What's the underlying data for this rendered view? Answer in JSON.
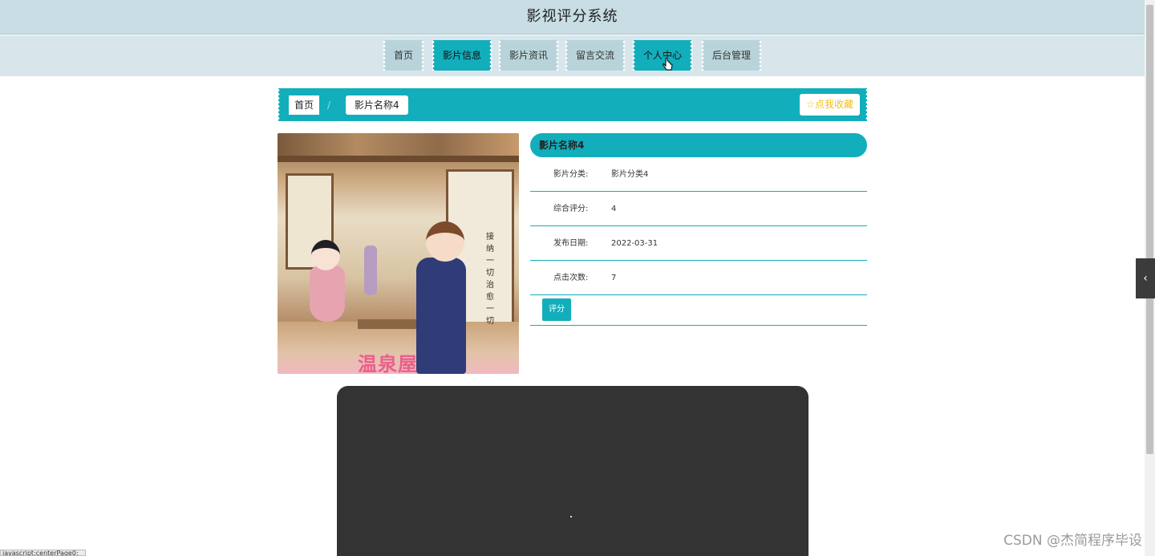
{
  "header": {
    "title": "影视评分系统"
  },
  "nav": {
    "items": [
      {
        "label": "首页",
        "active": false
      },
      {
        "label": "影片信息",
        "active": true
      },
      {
        "label": "影片资讯",
        "active": false
      },
      {
        "label": "留言交流",
        "active": false
      },
      {
        "label": "个人中心",
        "active": true
      },
      {
        "label": "后台管理",
        "active": false
      }
    ]
  },
  "breadcrumb": {
    "home": "首页",
    "separator": "/",
    "current": "影片名称4",
    "favorite_label": "☆点我收藏"
  },
  "poster": {
    "vertical_text": "接纳一切治愈一切",
    "logo_text": "温泉屋"
  },
  "movie": {
    "name": "影片名称4",
    "fields": [
      {
        "label": "影片分类:",
        "value": "影片分类4"
      },
      {
        "label": "综合评分:",
        "value": "4"
      },
      {
        "label": "发布日期:",
        "value": "2022-03-31"
      },
      {
        "label": "点击次数:",
        "value": "7"
      }
    ],
    "rate_button": "评分"
  },
  "side_tab": {
    "icon": "chevron-left-icon",
    "glyph": "‹"
  },
  "status_bar": {
    "text": "javascript:centerPage0;"
  },
  "watermark": {
    "text": "CSDN @杰简程序毕设"
  },
  "colors": {
    "accent": "#12aebb",
    "header_bg": "#c8dde4",
    "nav_bg": "#d8e6ec",
    "favorite": "#f3c01a",
    "player": "#333333"
  }
}
